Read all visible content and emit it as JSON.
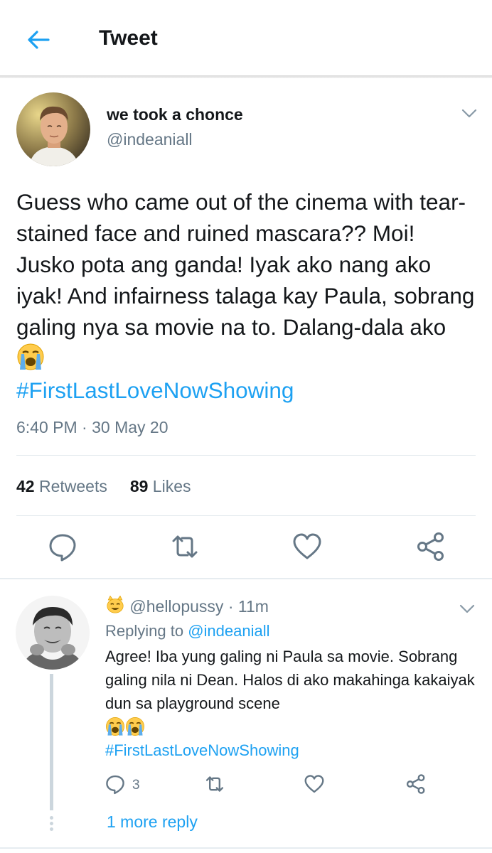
{
  "header": {
    "title": "Tweet",
    "back_icon": "arrow-left-icon",
    "accent": "#1da1f2"
  },
  "tweet": {
    "author_name": "we took a chonce",
    "author_handle": "@indeaniall",
    "text_main": "Guess who came out of the cinema with tear-stained face and ruined mascara?? Moi! Jusko pota ang ganda! Iyak ako nang ako iyak! And infairness talaga kay Paula, sobrang galing nya sa movie na to. Dalang-dala ako",
    "emoji": "loudly-crying-face-icon",
    "hashtag": "#FirstLastLoveNowShowing",
    "timestamp": "6:40 PM · 30 May 20",
    "retweets_count": "42",
    "retweets_label": "Retweets",
    "likes_count": "89",
    "likes_label": "Likes",
    "actions": [
      "reply-icon",
      "retweet-icon",
      "like-icon",
      "share-icon"
    ]
  },
  "reply": {
    "handle": "@hellopussy",
    "time": "· 11m",
    "replying_prefix": "Replying to",
    "replying_to": "@indeaniall",
    "text": "Agree! Iba yung galing ni Paula sa movie. Sobrang galing nila ni Dean. Halos di ako makahinga kakaiyak dun sa playground scene",
    "hashtag": "#FirstLastLoveNowShowing",
    "reply_count": "3",
    "more_replies": "1 more reply"
  },
  "colors": {
    "link": "#1da1f2",
    "secondary_text": "#657786",
    "primary_text": "#14171a"
  }
}
